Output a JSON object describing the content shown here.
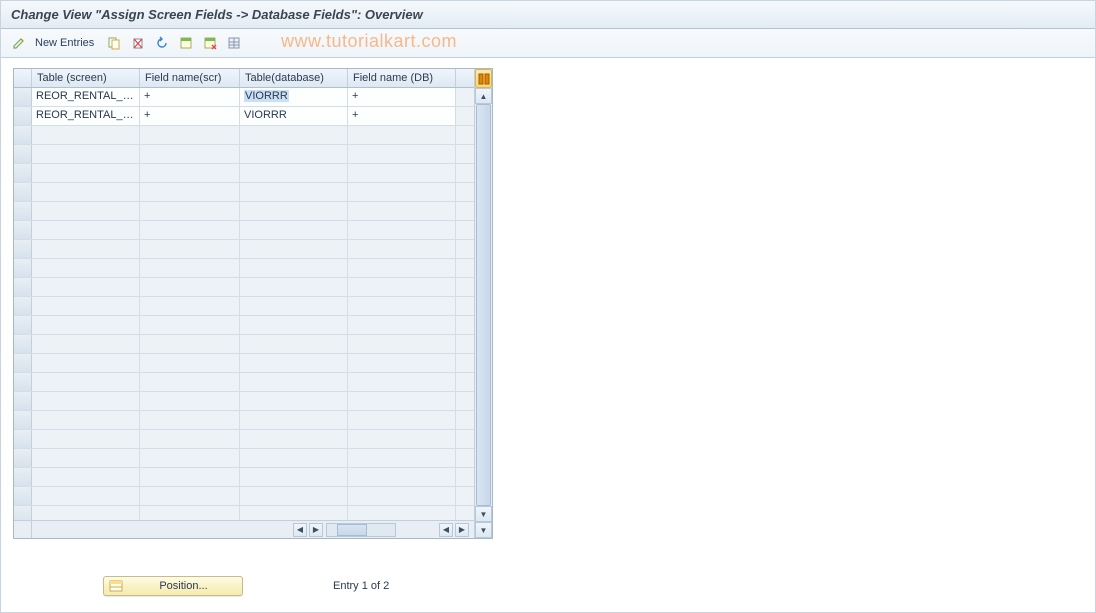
{
  "title": "Change View \"Assign Screen Fields -> Database Fields\": Overview",
  "toolbar": {
    "new_entries": "New Entries"
  },
  "watermark": "www.tutorialkart.com",
  "columns": {
    "c1": "Table (screen)",
    "c2": "Field name(scr)",
    "c3": "Table(database)",
    "c4": "Field name (DB)"
  },
  "rows": [
    {
      "c1": "REOR_RENTAL_RE..",
      "c2": "+",
      "c3": "VIORRR",
      "c4": "+",
      "highlight_c3": true
    },
    {
      "c1": "REOR_RENTAL_RE..",
      "c2": "+",
      "c3": "VIORRR",
      "c4": "+",
      "highlight_c3": false
    }
  ],
  "empty_rows": 21,
  "position_btn": "Position...",
  "entry_status": "Entry 1 of 2"
}
